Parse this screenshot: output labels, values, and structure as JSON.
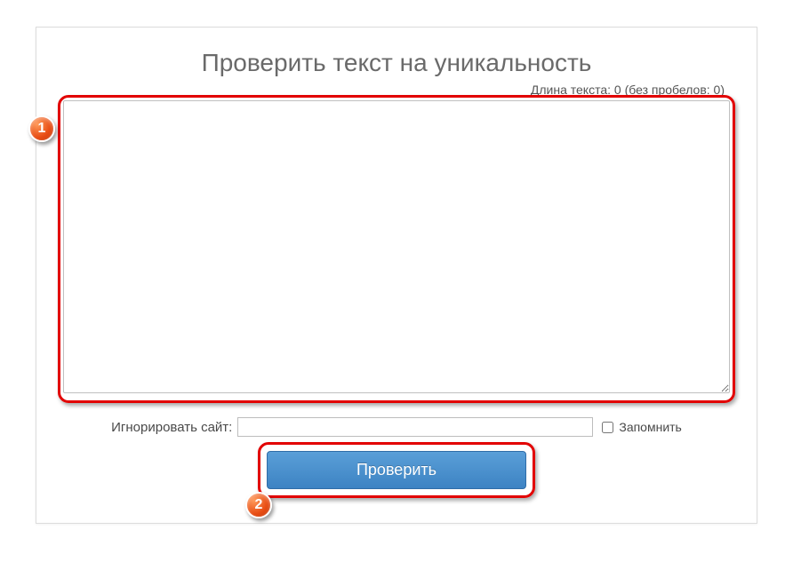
{
  "title": "Проверить текст на уникальность",
  "length_info": "Длина текста: 0 (без пробелов: 0)",
  "textarea_value": "",
  "ignore": {
    "label": "Игнорировать сайт:",
    "value": "",
    "remember_label": "Запомнить"
  },
  "button": {
    "check_label": "Проверить"
  },
  "callouts": {
    "one": "1",
    "two": "2"
  }
}
